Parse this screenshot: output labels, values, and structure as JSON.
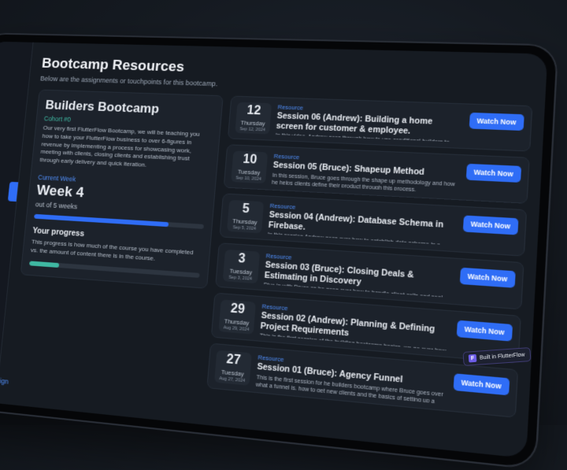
{
  "page": {
    "title": "Bootcamp Resources",
    "subtitle": "Below are the assignments or touchpoints for this bootcamp."
  },
  "sidebar": {
    "footer_link": "flutterflow.design"
  },
  "bootcamp": {
    "title": "Builders Bootcamp",
    "cohort": "Cohort #0",
    "description": "Our very first FlutterFlow Bootcamp, we will be teaching you how to take your FlutterFlow business to over 6-figures in revenue by implementing a process for showcasing work, meeting with clients, closing clients and establishing trust through early delivery and quick iteration.",
    "current_week_label": "Current Week",
    "week": "Week 4",
    "out_of": "out of 5 weeks",
    "week_progress": 0.8
  },
  "progress": {
    "title": "Your progress",
    "description": "This progress is how much of the course you have completed vs. the amount of content there is in the course.",
    "value": 0.18
  },
  "sessions": [
    {
      "day": "12",
      "dow": "Thursday",
      "date": "Sep 12, 2024",
      "tag": "Resource",
      "title": "Session 06 (Andrew): Building a home screen for customer & employee.",
      "desc": "In this video, Andrew goes through how to use conditional builders to segment views per user type, we also build a custom toggle widget the show month and week views in calendar form.",
      "button": "Watch Now"
    },
    {
      "day": "10",
      "dow": "Tuesday",
      "date": "Sep 10, 2024",
      "tag": "Resource",
      "title": "Session 05 (Bruce): Shapeup Method",
      "desc": "In this session, Bruce goes through the shape up methodology and how he helps clients define their product through this process.",
      "button": "Watch Now"
    },
    {
      "day": "5",
      "dow": "Thursday",
      "date": "Sep 5, 2024",
      "tag": "Resource",
      "title": "Session 04 (Andrew): Database Schema in Firebase.",
      "desc": "In this session Andrew goes over how to establish data schema in a scalable way for your applications, and touches on best practices when establishing your data with querying in mind.",
      "button": "Watch Now"
    },
    {
      "day": "3",
      "dow": "Tuesday",
      "date": "Sep 3, 2024",
      "tag": "Resource",
      "title": "Session 03 (Bruce): Closing Deals & Estimating in Discovery",
      "desc": "Dive in with Bruce as he goes over how to handle client calls and seal the deal and close a discovery project with the client.",
      "button": "Watch Now"
    },
    {
      "day": "29",
      "dow": "Thursday",
      "date": "Aug 29, 2024",
      "tag": "Resource",
      "title": "Session 02 (Andrew): Planning & Defining Project Requirements",
      "desc": "This is the first session of the building bootcamp basics, we go over how to manage clients in the beginning and helping to define project requirements before diving into planning and defining screens needed and thumbnail wireframes.",
      "button": "Watch Now"
    },
    {
      "day": "27",
      "dow": "Tuesday",
      "date": "Aug 27, 2024",
      "tag": "Resource",
      "title": "Session 01 (Bruce): Agency Funnel",
      "desc": "This is the first session for he builders bootcamp where Bruce goes over what a funnel is, how to get new clients and the basics of setting up a recurring business strategy of new clients.",
      "button": "Watch Now"
    }
  ],
  "badge": {
    "text": "Built in FlutterFlow",
    "icon": "flutterflow-logo-icon"
  },
  "colors": {
    "accent": "#2f6df6",
    "teal": "#3fb8a2",
    "background": "#161b22"
  }
}
